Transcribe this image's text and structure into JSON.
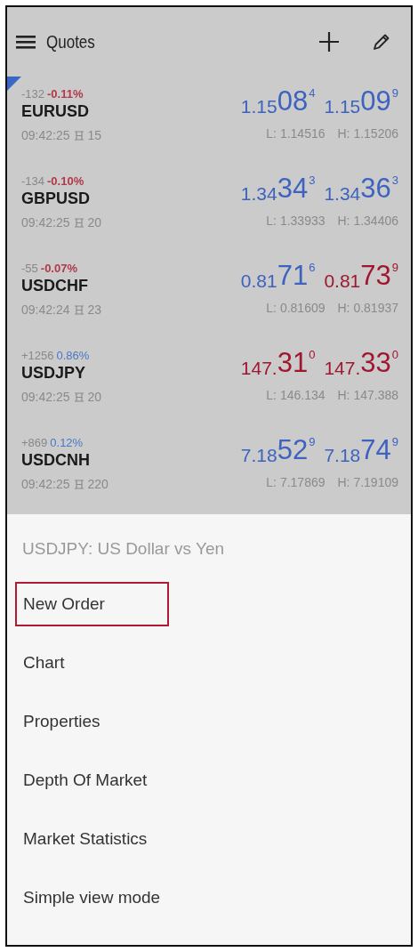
{
  "header": {
    "title": "Quotes"
  },
  "quotes": [
    {
      "symbol": "EURUSD",
      "marked": true,
      "change_points": "-132",
      "change_percent": "-0.11%",
      "change_rising": false,
      "time": "09:42:25",
      "spread": "15",
      "low": "L: 1.14516",
      "high": "H: 1.15206",
      "bid": {
        "head": "1.15",
        "big": "08",
        "sup": "4",
        "rising": true
      },
      "ask": {
        "head": "1.15",
        "big": "09",
        "sup": "9",
        "rising": true
      }
    },
    {
      "symbol": "GBPUSD",
      "marked": false,
      "change_points": "-134",
      "change_percent": "-0.10%",
      "change_rising": false,
      "time": "09:42:25",
      "spread": "20",
      "low": "L: 1.33933",
      "high": "H: 1.34406",
      "bid": {
        "head": "1.34",
        "big": "34",
        "sup": "3",
        "rising": true
      },
      "ask": {
        "head": "1.34",
        "big": "36",
        "sup": "3",
        "rising": true
      }
    },
    {
      "symbol": "USDCHF",
      "marked": false,
      "change_points": "-55",
      "change_percent": "-0.07%",
      "change_rising": false,
      "time": "09:42:24",
      "spread": "23",
      "low": "L: 0.81609",
      "high": "H: 0.81937",
      "bid": {
        "head": "0.81",
        "big": "71",
        "sup": "6",
        "rising": true
      },
      "ask": {
        "head": "0.81",
        "big": "73",
        "sup": "9",
        "rising": false
      }
    },
    {
      "symbol": "USDJPY",
      "marked": false,
      "change_points": "+1256",
      "change_percent": "0.86%",
      "change_rising": true,
      "time": "09:42:25",
      "spread": "20",
      "low": "L: 146.134",
      "high": "H: 147.388",
      "bid": {
        "head": "147.",
        "big": "31",
        "sup": "0",
        "rising": false
      },
      "ask": {
        "head": "147.",
        "big": "33",
        "sup": "0",
        "rising": false
      }
    },
    {
      "symbol": "USDCNH",
      "marked": false,
      "change_points": "+869",
      "change_percent": "0.12%",
      "change_rising": true,
      "time": "09:42:25",
      "spread": "220",
      "low": "L: 7.17869",
      "high": "H: 7.19109",
      "bid": {
        "head": "7.18",
        "big": "52",
        "sup": "9",
        "rising": true
      },
      "ask": {
        "head": "7.18",
        "big": "74",
        "sup": "9",
        "rising": true
      }
    }
  ],
  "menu": {
    "title": "USDJPY: US Dollar vs Yen",
    "items": [
      {
        "label": "New Order",
        "highlighted": true
      },
      {
        "label": "Chart",
        "highlighted": false
      },
      {
        "label": "Properties",
        "highlighted": false
      },
      {
        "label": "Depth Of Market",
        "highlighted": false
      },
      {
        "label": "Market Statistics",
        "highlighted": false
      },
      {
        "label": "Simple view mode",
        "highlighted": false
      }
    ]
  }
}
